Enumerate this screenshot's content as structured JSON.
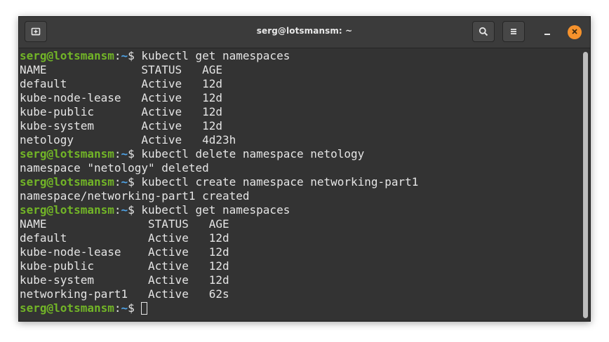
{
  "window": {
    "title": "serg@lotsmansm: ~"
  },
  "titlebar": {
    "new_tab_icon": "new-tab-icon",
    "search_icon": "search-icon",
    "menu_icon": "hamburger-menu-icon",
    "minimize_icon": "minimize-icon",
    "close_icon": "close-icon",
    "close_color": "#f6922c"
  },
  "prompt": {
    "user_host": "serg@lotsmansm",
    "colon": ":",
    "path": "~",
    "symbol": "$ "
  },
  "colors": {
    "background": "#333333",
    "user_host": "#72b527",
    "path": "#4fa4e8",
    "text": "#e5e5e5"
  },
  "lines": [
    {
      "type": "cmd",
      "text": "kubectl get namespaces"
    },
    {
      "type": "out",
      "text": "NAME              STATUS   AGE"
    },
    {
      "type": "out",
      "text": "default           Active   12d"
    },
    {
      "type": "out",
      "text": "kube-node-lease   Active   12d"
    },
    {
      "type": "out",
      "text": "kube-public       Active   12d"
    },
    {
      "type": "out",
      "text": "kube-system       Active   12d"
    },
    {
      "type": "out",
      "text": "netology          Active   4d23h"
    },
    {
      "type": "cmd",
      "text": "kubectl delete namespace netology"
    },
    {
      "type": "out",
      "text": "namespace \"netology\" deleted"
    },
    {
      "type": "cmd",
      "text": "kubectl create namespace networking-part1"
    },
    {
      "type": "out",
      "text": "namespace/networking-part1 created"
    },
    {
      "type": "cmd",
      "text": "kubectl get namespaces"
    },
    {
      "type": "out",
      "text": "NAME               STATUS   AGE"
    },
    {
      "type": "out",
      "text": "default            Active   12d"
    },
    {
      "type": "out",
      "text": "kube-node-lease    Active   12d"
    },
    {
      "type": "out",
      "text": "kube-public        Active   12d"
    },
    {
      "type": "out",
      "text": "kube-system        Active   12d"
    },
    {
      "type": "out",
      "text": "networking-part1   Active   62s"
    },
    {
      "type": "prompt",
      "text": ""
    }
  ]
}
